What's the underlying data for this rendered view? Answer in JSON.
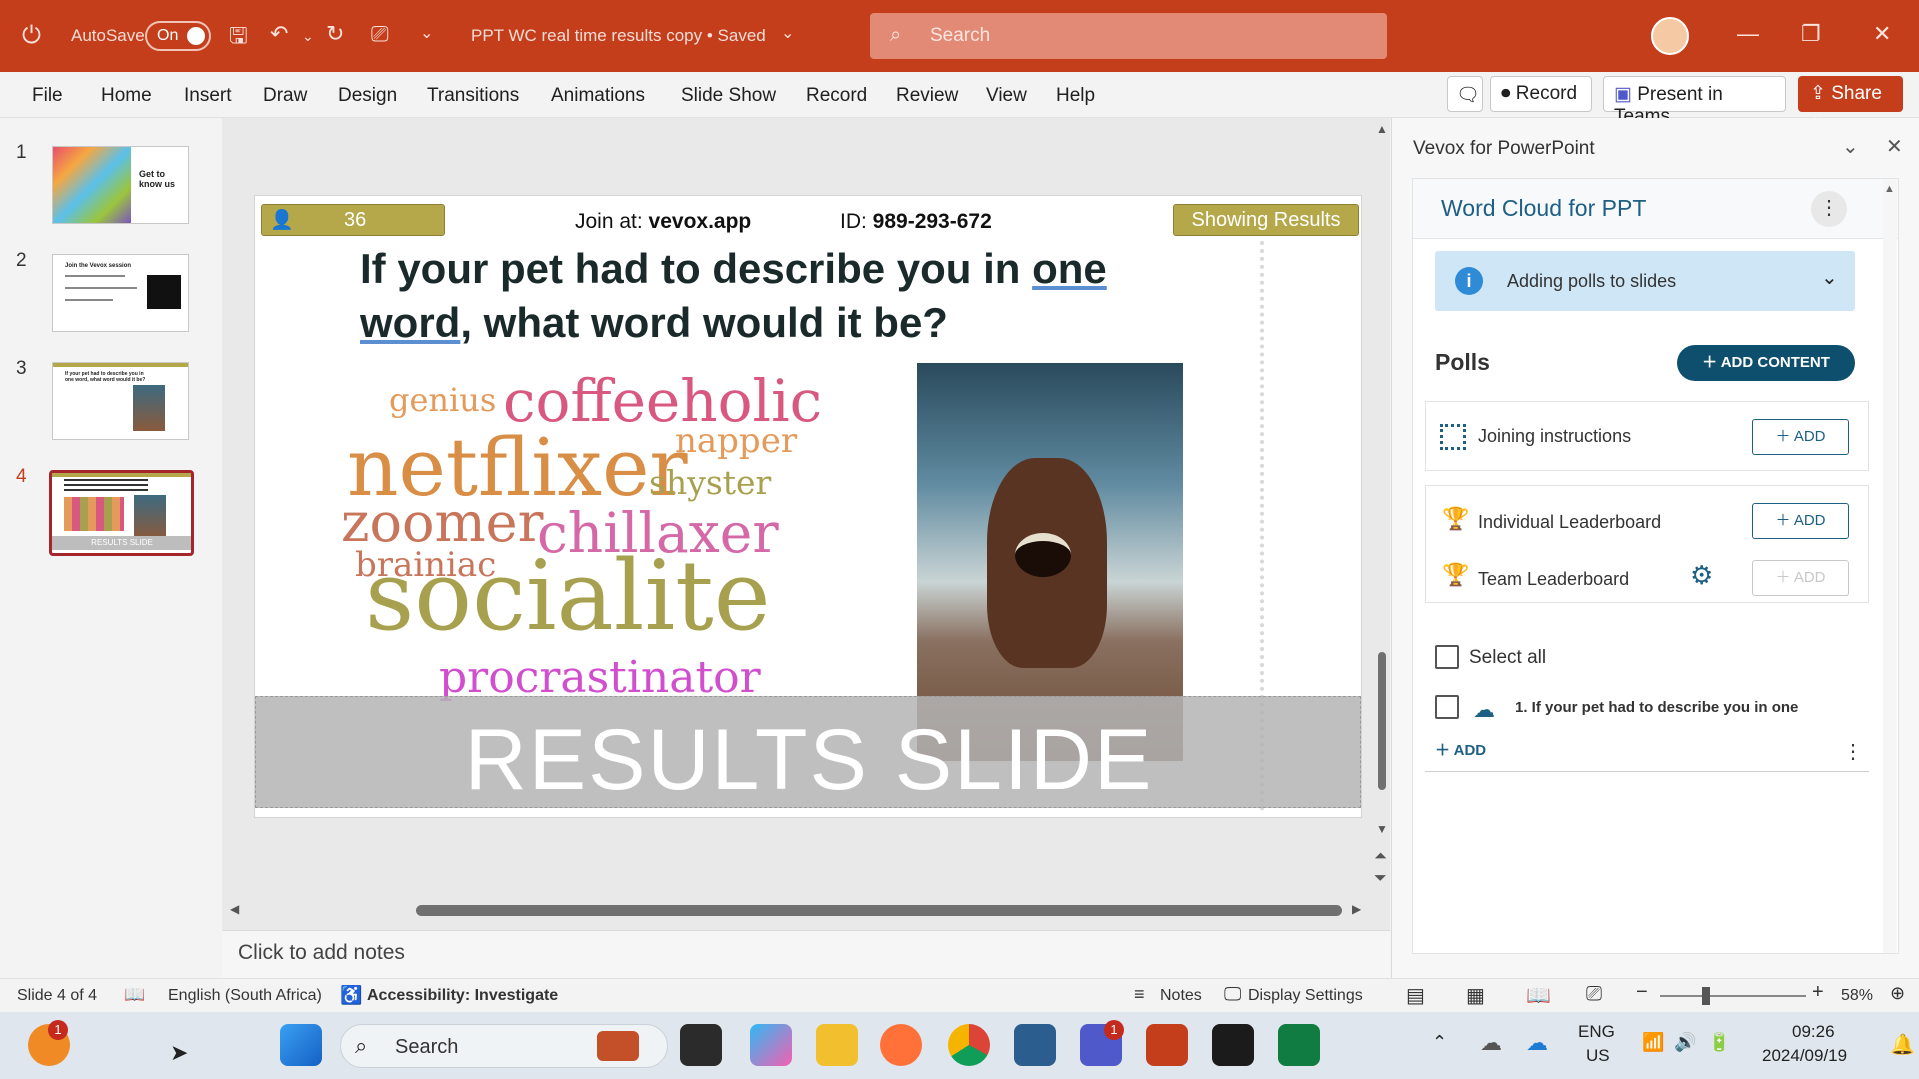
{
  "titlebar": {
    "autosave_label": "AutoSave",
    "autosave_state": "On",
    "doc_title": "PPT WC real time results copy • Saved",
    "search_placeholder": "Search"
  },
  "ribbon": {
    "tabs": [
      "File",
      "Home",
      "Insert",
      "Draw",
      "Design",
      "Transitions",
      "Animations",
      "Slide Show",
      "Record",
      "Review",
      "View",
      "Help"
    ],
    "record_btn": "Record",
    "teams_btn": "Present in Teams",
    "share_btn": "Share"
  },
  "thumbnails": [
    {
      "num": "1",
      "text": "Get to know us"
    },
    {
      "num": "2",
      "text": "Join the Vevox session"
    },
    {
      "num": "3",
      "text": "If your pet had to describe you in one word, what word would it be?"
    },
    {
      "num": "4",
      "text": "RESULTS SLIDE",
      "active": true
    }
  ],
  "slide": {
    "participants": "36",
    "join_label": "Join at: ",
    "join_site": "vevox.app",
    "id_label": "ID: ",
    "id_value": "989-293-672",
    "status_btn": "Showing Results",
    "question_a": "If your pet had to describe you in ",
    "question_u1": "one",
    "question_u2": "word",
    "question_b": ", what word would it be?",
    "overlay_label": "RESULTS SLIDE",
    "words": [
      {
        "text": "genius",
        "color": "#e39a5a"
      },
      {
        "text": "coffeeholic",
        "color": "#d9587f"
      },
      {
        "text": "napper",
        "color": "#e39a5a"
      },
      {
        "text": "netflixer",
        "color": "#d88e45"
      },
      {
        "text": "shyster",
        "color": "#a7a04f"
      },
      {
        "text": "zoomer",
        "color": "#c8755b"
      },
      {
        "text": "chillaxer",
        "color": "#d568a6"
      },
      {
        "text": "brainiac",
        "color": "#c8755b"
      },
      {
        "text": "socialite",
        "color": "#a7a04f"
      },
      {
        "text": "procrastinator",
        "color": "#d14fcf"
      }
    ]
  },
  "notes_placeholder": "Click to add notes",
  "pane": {
    "title": "Vevox for PowerPoint",
    "presentation": "Word Cloud for PPT",
    "info": "Adding polls to slides",
    "polls_heading": "Polls",
    "add_content": "ADD CONTENT",
    "joining": "Joining instructions",
    "individual": "Individual Leaderboard",
    "team": "Team Leaderboard",
    "add": "ADD",
    "select_all": "Select all",
    "poll1": "1. If your pet had to describe you in one",
    "add_link": "ADD"
  },
  "statusbar": {
    "slide": "Slide 4 of 4",
    "language": "English (South Africa)",
    "accessibility": "Accessibility: Investigate",
    "notes": "Notes",
    "display": "Display Settings",
    "zoom": "58%"
  },
  "taskbar": {
    "search": "Search",
    "lang1": "ENG",
    "lang2": "US",
    "time": "09:26",
    "date": "2024/09/19",
    "badge_teams": "1",
    "badge_firefox": "1"
  },
  "colors": {
    "accent": "#c43e1c",
    "vevox": "#1e5f84",
    "badge_olive": "#b5a84a"
  }
}
